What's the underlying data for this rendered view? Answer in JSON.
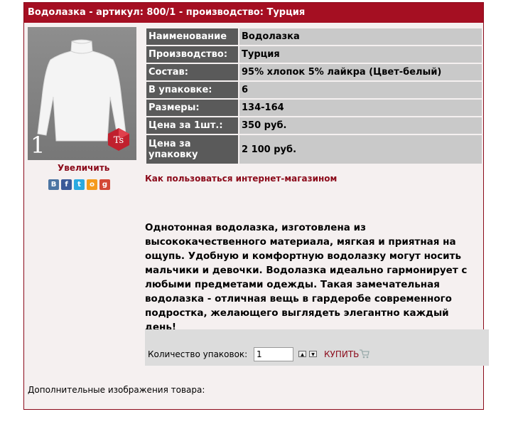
{
  "product": {
    "title": "Водолазка - артикул: 800/1 - производство: Турция",
    "photo_number": "1",
    "brand_logo_text": "Ts",
    "zoom_label": "Увеличить",
    "social_icons": [
      "vk",
      "facebook",
      "twitter",
      "odnoklassniki",
      "google-plus"
    ],
    "specs": [
      {
        "key": "Наименование",
        "value": "Водолазка"
      },
      {
        "key": "Производство:",
        "value": "Турция"
      },
      {
        "key": "Состав:",
        "value": "95% хлопок 5% лайкра (Цвет-белый)"
      },
      {
        "key": "В упаковке:",
        "value": "6"
      },
      {
        "key": "Размеры:",
        "value": "134-164"
      },
      {
        "key": "Цена за 1шт.:",
        "value": "350 руб."
      },
      {
        "key": "Цена за упаковку",
        "value": "2 100 руб."
      }
    ],
    "howto_link": "Как пользоваться интернет-магазином",
    "description": "Однотонная водолазка, изготовлена из  высококачественного материала, мягкая и приятная на ощупь. Удобную и комфортную водолазку могут носить мальчики и девочки. Водолазка идеально гармонирует с любыми предметами одежды. Такая замечательная водолазка  - отличная вещь в гардеробе современного подростка, желающего выглядеть элегантно каждый  день!",
    "order": {
      "qty_label": "Количество упаковок:",
      "qty_value": "1",
      "buy_label": "КУПИТЬ"
    },
    "extra_images_label": "Дополнительные изображения товара:"
  },
  "colors": {
    "accent": "#a50f22",
    "key_cell": "#5a5a5a",
    "value_cell": "#c9c9c9"
  }
}
